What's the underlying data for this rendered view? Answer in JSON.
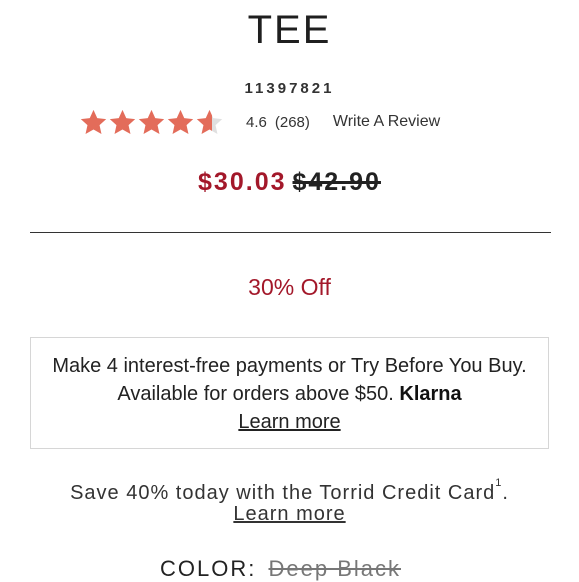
{
  "product": {
    "title": "TEE",
    "sku": "11397821"
  },
  "rating": {
    "stars_filled": 4.6,
    "stars_total": 5,
    "value": "4.6",
    "count": "(268)",
    "write_review_label": "Write A Review",
    "star_color": "#e36c5a",
    "star_empty_color": "#e0e0e0"
  },
  "price": {
    "sale": "$30.03",
    "original": "$42.90",
    "sale_color": "#a3182a"
  },
  "discount": {
    "label": "30% Off"
  },
  "klarna": {
    "text": "Make 4 interest-free payments or Try Before You Buy. Available for orders above $50.",
    "brand": "Klarna",
    "link_label": "Learn more"
  },
  "credit": {
    "text": "Save 40% today with the Torrid Credit Card",
    "footnote": "1",
    "suffix": ".",
    "link_label": "Learn more"
  },
  "color": {
    "label": "COLOR:",
    "value": "Deep Black"
  }
}
